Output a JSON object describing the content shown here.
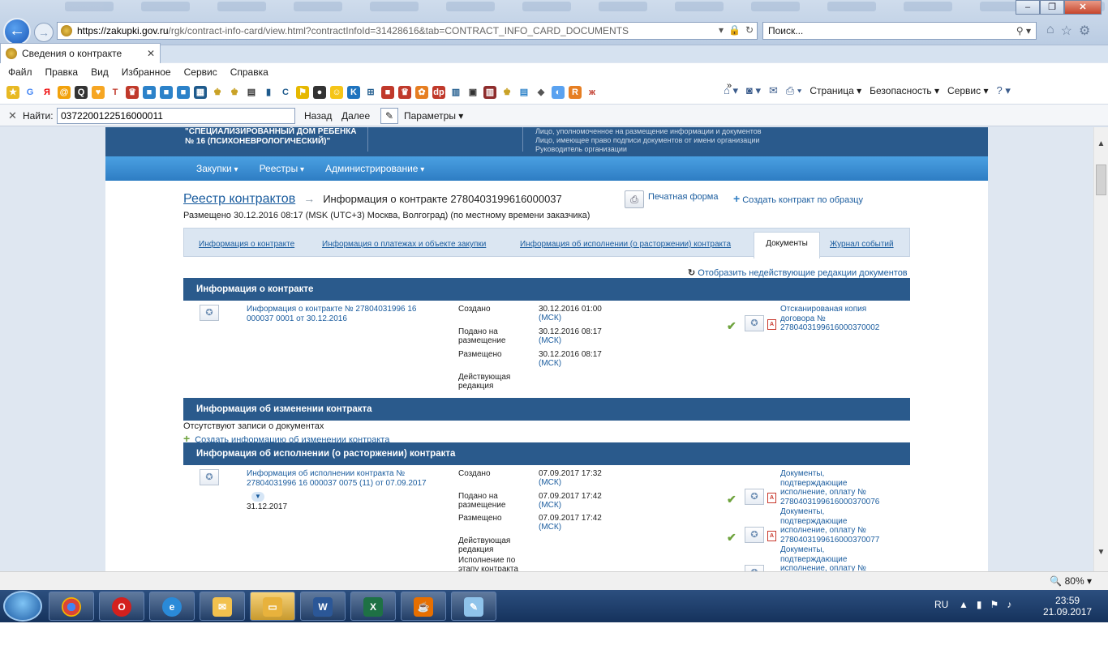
{
  "browser": {
    "url_host": "https://zakupki.gov.ru",
    "url_rest": "/rgk/contract-info-card/view.html?contractInfoId=31428616&tab=CONTRACT_INFO_CARD_DOCUMENTS",
    "search_placeholder": "Поиск...",
    "tab_title": "Сведения о контракте",
    "window_controls": [
      "–",
      "❐",
      "✕"
    ]
  },
  "menu": [
    "Файл",
    "Правка",
    "Вид",
    "Избранное",
    "Сервис",
    "Справка"
  ],
  "command_bar": {
    "page": "Страница",
    "security": "Безопасность",
    "service": "Сервис"
  },
  "find_bar": {
    "label": "Найти:",
    "value": "0372200122516000011",
    "prev": "Назад",
    "next": "Далее",
    "options": "Параметры"
  },
  "org": {
    "name": "\"СПЕЦИАЛИЗИРОВАННЫЙ ДОМ РЕБЕНКА № 16 (ПСИХОНЕВРОЛОГИЧЕСКИЙ)\"",
    "roles": [
      "Лицо, уполномоченное на размещение информации и документов",
      "Лицо, имеющее право подписи документов от имени организации",
      "Руководитель организации"
    ]
  },
  "main_nav": [
    "Закупки",
    "Реестры",
    "Администрирование"
  ],
  "breadcrumb": {
    "root": "Реестр контрактов",
    "current": "Информация о контракте 2780403199616000037"
  },
  "placed_note": "Размещено 30.12.2016 08:17 (MSK (UTC+3) Москва, Волгоград) (по местному времени заказчика)",
  "actions": {
    "print": "Печатная форма",
    "create": "Создать контракт по образцу"
  },
  "page_tabs": [
    "Информация о контракте",
    "Информация о платежах и объекте закупки",
    "Информация об исполнении (о расторжении) контракта",
    "Документы",
    "Журнал событий"
  ],
  "show_inactive": "Отобразить недействующие редакции документов",
  "section1": {
    "title": "Информация о контракте",
    "doc": "Информация о контракте № 27804031996 16 000037 0001 от 30.12.2016",
    "labels": [
      "Создано",
      "Подано на размещение",
      "Размещено",
      "Действующая редакция"
    ],
    "dates": [
      "30.12.2016 01:00",
      "30.12.2016 08:17",
      "30.12.2016 08:17"
    ],
    "tz": "(МСК)",
    "attachment": "Отсканированая копия договора № 2780403199616000370002"
  },
  "section2": {
    "title": "Информация об изменении контракта",
    "no_records": "Отсутствуют записи о документах",
    "add": "Создать информацию об изменении контракта"
  },
  "section3": {
    "title": "Информация об исполнении (о расторжении) контракта",
    "doc": "Информация об исполнении контракта № 27804031996 16 000037 0075 (11) от 07.09.2017",
    "extra_date": "31.12.2017",
    "labels": [
      "Создано",
      "Подано на размещение",
      "Размещено",
      "Действующая редакция",
      "Исполнение по этапу контракта"
    ],
    "dates": [
      "07.09.2017 17:32",
      "07.09.2017 17:42",
      "07.09.2017 17:42"
    ],
    "tz": "(МСК)",
    "attachments": [
      "Документы, подтверждающие исполнение, оплату № 2780403199616000370076",
      "Документы, подтверждающие исполнение, оплату № 2780403199616000370077",
      "Документы, подтверждающие исполнение, оплату №"
    ]
  },
  "status": {
    "zoom": "80%"
  },
  "taskbar": {
    "lang": "RU",
    "time": "23:59",
    "date": "21.09.2017"
  }
}
